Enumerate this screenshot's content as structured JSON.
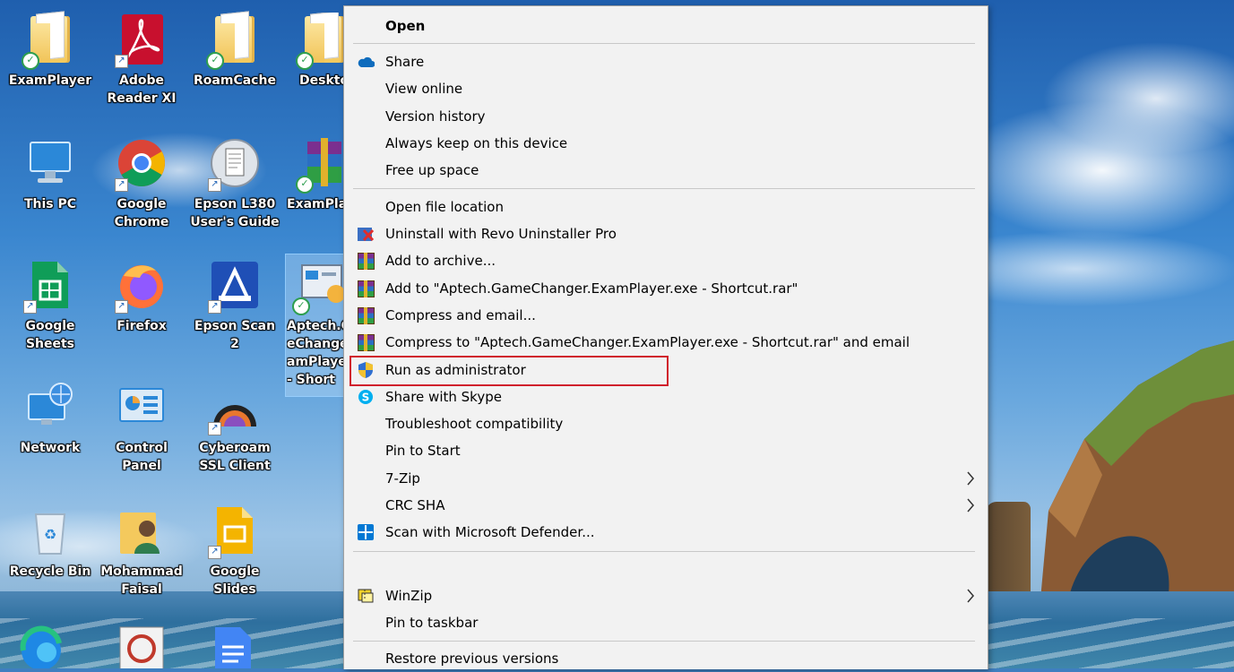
{
  "desktop": {
    "icons": [
      {
        "label": "ExamPlayer",
        "icon": "folder-synced-icon"
      },
      {
        "label": "Adobe\nReader XI",
        "icon": "adobe-reader-icon"
      },
      {
        "label": "RoamCache",
        "icon": "folder-synced-icon"
      },
      {
        "label": "Deskto",
        "icon": "folder-synced-icon"
      },
      {
        "label": "This PC",
        "icon": "computer-icon"
      },
      {
        "label": "Google\nChrome",
        "icon": "chrome-icon"
      },
      {
        "label": "Epson L380\nUser's Guide",
        "icon": "epson-guide-icon"
      },
      {
        "label": "ExamPla",
        "icon": "winrar-archive-icon"
      },
      {
        "label": "Google\nSheets",
        "icon": "google-sheets-icon"
      },
      {
        "label": "Firefox",
        "icon": "firefox-icon"
      },
      {
        "label": "Epson Scan 2",
        "icon": "epson-scan-icon"
      },
      {
        "label": "Aptech.G\neChange\namPlaye\n- Short",
        "icon": "exam-player-shortcut-icon"
      },
      {
        "label": "Network",
        "icon": "network-icon"
      },
      {
        "label": "Control\nPanel",
        "icon": "control-panel-icon"
      },
      {
        "label": "Cyberoam\nSSL Client",
        "icon": "cyberoam-icon"
      },
      {
        "label": "Recycle Bin",
        "icon": "recycle-bin-icon"
      },
      {
        "label": "Mohammad\nFaisal",
        "icon": "user-folder-icon"
      },
      {
        "label": "Google Slides",
        "icon": "google-slides-icon"
      }
    ]
  },
  "context_menu": {
    "items": [
      {
        "label": "Open",
        "icon": "",
        "bold": true
      },
      {
        "label": "Share",
        "icon": "onedrive-cloud-icon"
      },
      {
        "label": "View online",
        "icon": ""
      },
      {
        "label": "Version history",
        "icon": ""
      },
      {
        "label": "Always keep on this device",
        "icon": ""
      },
      {
        "label": "Free up space",
        "icon": ""
      },
      {
        "label": "Open file location",
        "icon": ""
      },
      {
        "label": "Uninstall with Revo Uninstaller Pro",
        "icon": "revo-uninstaller-icon"
      },
      {
        "label": "Add to archive...",
        "icon": "winrar-icon"
      },
      {
        "label": "Add to \"Aptech.GameChanger.ExamPlayer.exe - Shortcut.rar\"",
        "icon": "winrar-icon"
      },
      {
        "label": "Compress and email...",
        "icon": "winrar-icon"
      },
      {
        "label": "Compress to \"Aptech.GameChanger.ExamPlayer.exe - Shortcut.rar\" and email",
        "icon": "winrar-icon"
      },
      {
        "label": "Run as administrator",
        "icon": "uac-shield-icon",
        "highlighted": true
      },
      {
        "label": "Share with Skype",
        "icon": "skype-icon"
      },
      {
        "label": "Troubleshoot compatibility",
        "icon": ""
      },
      {
        "label": "Pin to Start",
        "icon": ""
      },
      {
        "label": "7-Zip",
        "icon": "",
        "submenu": true
      },
      {
        "label": "CRC SHA",
        "icon": "",
        "submenu": true
      },
      {
        "label": "Scan with Microsoft Defender...",
        "icon": "defender-icon"
      },
      {
        "label": "WinZip",
        "icon": "winzip-icon",
        "submenu": true
      },
      {
        "label": "Pin to taskbar",
        "icon": ""
      },
      {
        "label": "Restore previous versions",
        "icon": ""
      }
    ],
    "submenu_arrow": "›",
    "highlight_color": "#d0202c"
  },
  "colors": {
    "menu_bg": "#f2f2f2",
    "separator": "#c8c8c8",
    "onedrive": "#0f6cbd",
    "skype": "#00aff0",
    "defender": "#0078d4"
  }
}
